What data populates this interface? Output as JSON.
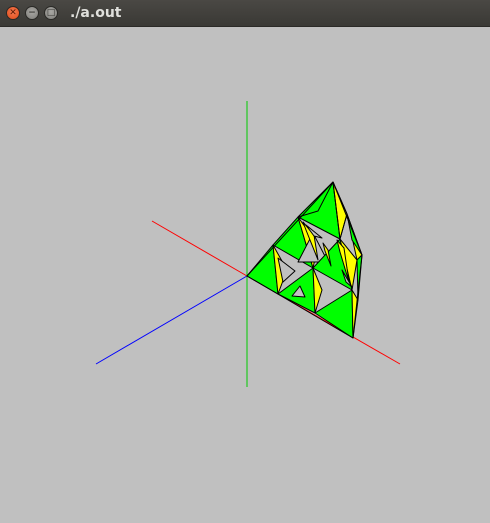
{
  "window": {
    "title": "./a.out",
    "buttons": {
      "close_glyph": "✕",
      "minimize_glyph": "−",
      "maximize_glyph": "□"
    }
  },
  "colors": {
    "background": "#c0c0c0",
    "x_axis": "#ff0000",
    "y_axis": "#00cc00",
    "z_axis": "#0000ff",
    "face_front": "#00ff00",
    "face_side": "#ffff00",
    "edge": "#000000"
  }
}
